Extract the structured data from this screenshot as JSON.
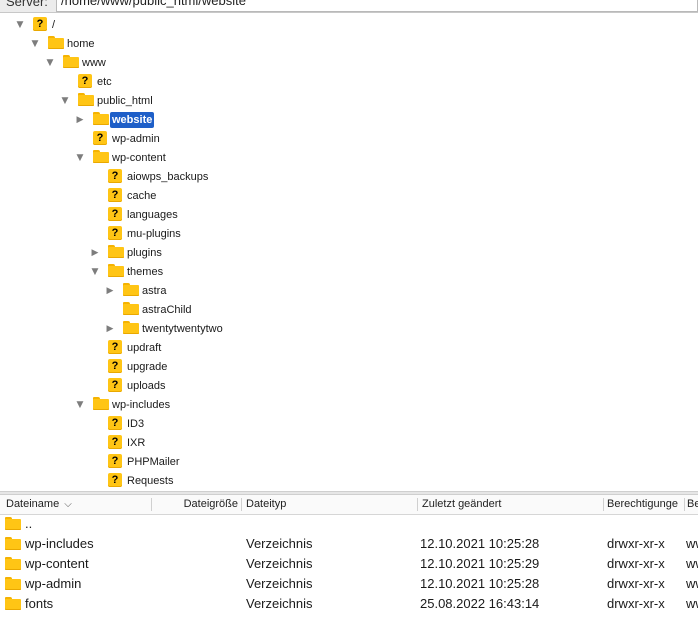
{
  "pathbar": {
    "label": "Server:",
    "path": "/home/www/public_html/website"
  },
  "tree": [
    {
      "label": "/",
      "icon": "question",
      "expanded": true,
      "toggle": true
    },
    {
      "label": "home",
      "icon": "folder",
      "expanded": true,
      "toggle": true
    },
    {
      "label": "www",
      "icon": "folder",
      "expanded": true,
      "toggle": true
    },
    {
      "label": "etc",
      "icon": "question",
      "toggle": false
    },
    {
      "label": "public_html",
      "icon": "folder",
      "expanded": true,
      "toggle": true
    },
    {
      "label": "website",
      "icon": "folder",
      "expanded": false,
      "toggle": true,
      "selected": true
    },
    {
      "label": "wp-admin",
      "icon": "question",
      "toggle": false
    },
    {
      "label": "wp-content",
      "icon": "folder",
      "expanded": true,
      "toggle": true
    },
    {
      "label": "aiowps_backups",
      "icon": "question",
      "toggle": false
    },
    {
      "label": "cache",
      "icon": "question",
      "toggle": false
    },
    {
      "label": "languages",
      "icon": "question",
      "toggle": false
    },
    {
      "label": "mu-plugins",
      "icon": "question",
      "toggle": false
    },
    {
      "label": "plugins",
      "icon": "folder",
      "expanded": false,
      "toggle": true
    },
    {
      "label": "themes",
      "icon": "folder",
      "expanded": true,
      "toggle": true
    },
    {
      "label": "astra",
      "icon": "folder",
      "expanded": false,
      "toggle": true
    },
    {
      "label": "astraChild",
      "icon": "folder",
      "toggle": false
    },
    {
      "label": "twentytwentytwo",
      "icon": "folder",
      "expanded": false,
      "toggle": true
    },
    {
      "label": "updraft",
      "icon": "question",
      "toggle": false
    },
    {
      "label": "upgrade",
      "icon": "question",
      "toggle": false
    },
    {
      "label": "uploads",
      "icon": "question",
      "toggle": false
    },
    {
      "label": "wp-includes",
      "icon": "folder",
      "expanded": true,
      "toggle": true
    },
    {
      "label": "ID3",
      "icon": "question",
      "toggle": false
    },
    {
      "label": "IXR",
      "icon": "question",
      "toggle": false
    },
    {
      "label": "PHPMailer",
      "icon": "question",
      "toggle": false
    },
    {
      "label": "Requests",
      "icon": "question",
      "toggle": false
    }
  ],
  "list": {
    "columns": {
      "name": "Dateiname",
      "size": "Dateigröße",
      "type": "Dateityp",
      "modified": "Zuletzt geändert",
      "permissions": "Berechtigunge",
      "owner": "Be"
    },
    "rows": [
      {
        "name": "..",
        "size": "",
        "type": "",
        "modified": "",
        "permissions": "",
        "owner": ""
      },
      {
        "name": "wp-includes",
        "size": "",
        "type": "Verzeichnis",
        "modified": "12.10.2021 10:25:28",
        "permissions": "drwxr-xr-x",
        "owner": "ww"
      },
      {
        "name": "wp-content",
        "size": "",
        "type": "Verzeichnis",
        "modified": "12.10.2021 10:25:29",
        "permissions": "drwxr-xr-x",
        "owner": "ww"
      },
      {
        "name": "wp-admin",
        "size": "",
        "type": "Verzeichnis",
        "modified": "12.10.2021 10:25:28",
        "permissions": "drwxr-xr-x",
        "owner": "ww"
      },
      {
        "name": "fonts",
        "size": "",
        "type": "Verzeichnis",
        "modified": "25.08.2022 16:43:14",
        "permissions": "drwxr-xr-x",
        "owner": "ww"
      }
    ]
  },
  "colors": {
    "folder": "#ffc515",
    "selection": "#1e5fc8"
  }
}
